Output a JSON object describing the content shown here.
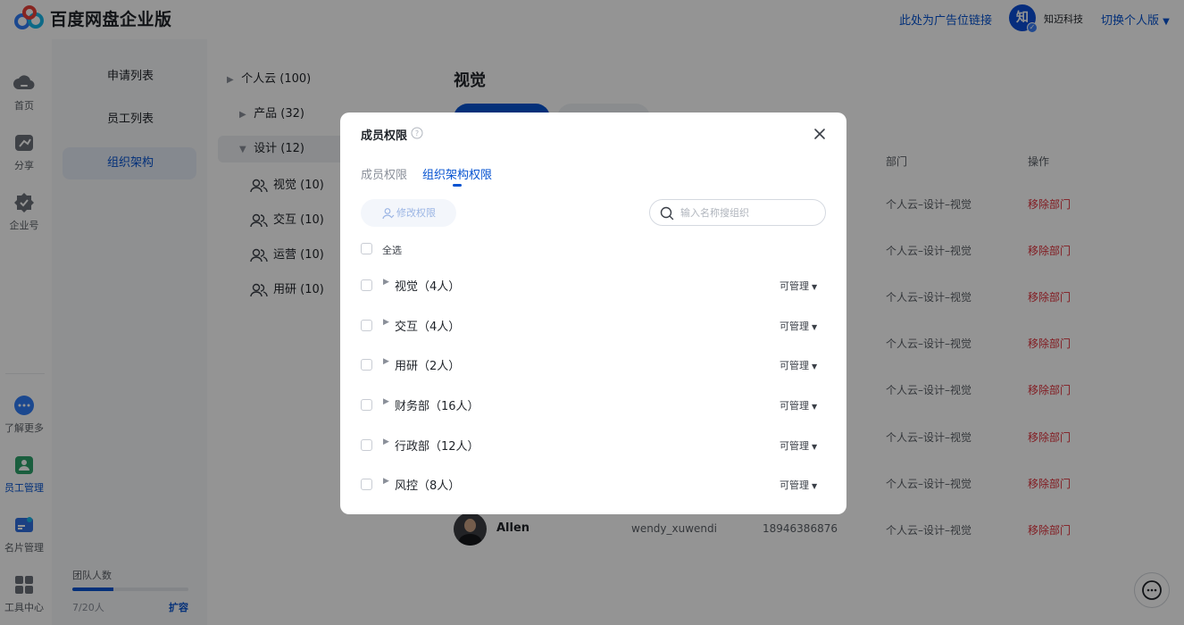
{
  "header": {
    "brand": "百度网盘企业版",
    "ad_link": "此处为广告位链接",
    "company_avatar_char": "知",
    "company_name": "知迈科技",
    "switch_label": "切换个人版"
  },
  "rail": {
    "items": [
      {
        "label": "首页",
        "icon": "cloud-icon"
      },
      {
        "label": "分享",
        "icon": "share-icon"
      },
      {
        "label": "企业号",
        "icon": "enterprise-icon"
      },
      {
        "label": "了解更多",
        "icon": "more-icon"
      },
      {
        "label": "员工管理",
        "icon": "staff-icon"
      },
      {
        "label": "名片管理",
        "icon": "card-icon"
      },
      {
        "label": "工具中心",
        "icon": "tools-icon"
      }
    ]
  },
  "subnav": {
    "items": [
      "申请列表",
      "员工列表",
      "组织架构"
    ],
    "team_label": "团队人数",
    "team_count": "7/20人",
    "team_progress": 0.35,
    "expand_label": "扩容"
  },
  "tree": {
    "groups": [
      "个人云 (100)",
      "产品 (32)",
      "设计 (12)"
    ],
    "leaves": [
      "视觉 (10)",
      "交互 (10)",
      "运营 (10)",
      "用研 (10)"
    ]
  },
  "main": {
    "title": "视觉",
    "columns": {
      "dept": "部门",
      "action": "操作"
    },
    "dept_value": "个人云–设计–视觉",
    "remove_label": "移除部门",
    "last_row": {
      "name": "Allen",
      "account": "wendy_xuwendi",
      "phone": "18946386876"
    }
  },
  "modal": {
    "title": "成员权限",
    "tabs": [
      "成员权限",
      "组织架构权限"
    ],
    "edit_button": "修改权限",
    "search_placeholder": "输入名称搜组织",
    "select_all": "全选",
    "rows": [
      {
        "name": "视觉（4人）",
        "perm": "可管理"
      },
      {
        "name": "交互（4人）",
        "perm": "可管理"
      },
      {
        "name": "用研（2人）",
        "perm": "可管理"
      },
      {
        "name": "财务部（16人）",
        "perm": "可管理"
      },
      {
        "name": "行政部（12人）",
        "perm": "可管理"
      },
      {
        "name": "风控（8人）",
        "perm": "可管理"
      }
    ]
  },
  "colors": {
    "accent": "#0653d1",
    "danger": "#e0303a",
    "overlay": "rgba(0,0,0,0.42)"
  }
}
